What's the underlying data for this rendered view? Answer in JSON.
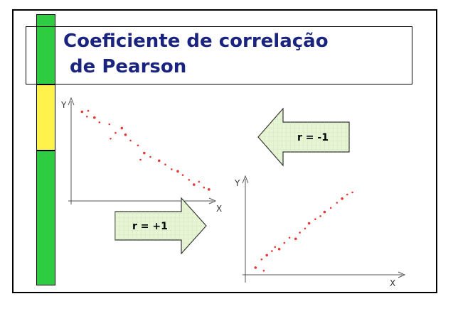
{
  "title": {
    "line1": "Coeficiente de correlação",
    "line2": " de Pearson"
  },
  "colors": {
    "bar_green": "#2ecc40",
    "bar_yellow": "#fff24d",
    "title_text": "#1a237e",
    "points": "#e53935",
    "arrow_fill": "#e7f5d4"
  },
  "arrows": {
    "negative": {
      "label": "r = -1",
      "direction": "left"
    },
    "positive": {
      "label": "r = +1",
      "direction": "right"
    }
  },
  "chart_data": [
    {
      "type": "scatter",
      "xlabel": "X",
      "ylabel": "Y",
      "points": [
        [
          0.3,
          9.3
        ],
        [
          0.8,
          9.4
        ],
        [
          0.7,
          8.8
        ],
        [
          1.3,
          8.7
        ],
        [
          1.7,
          8.2
        ],
        [
          2.5,
          8.0
        ],
        [
          3.5,
          7.6
        ],
        [
          3.0,
          7.1
        ],
        [
          2.6,
          6.5
        ],
        [
          3.8,
          6.9
        ],
        [
          4.2,
          6.3
        ],
        [
          4.8,
          5.8
        ],
        [
          5.3,
          5.0
        ],
        [
          5.0,
          4.3
        ],
        [
          5.8,
          4.6
        ],
        [
          6.5,
          4.2
        ],
        [
          7.0,
          3.8
        ],
        [
          7.5,
          3.3
        ],
        [
          8.0,
          3.1
        ],
        [
          8.4,
          2.7
        ],
        [
          8.9,
          2.2
        ],
        [
          9.3,
          1.7
        ],
        [
          9.7,
          2.0
        ],
        [
          10.1,
          1.4
        ],
        [
          10.5,
          1.2
        ]
      ]
    },
    {
      "type": "scatter",
      "xlabel": "X",
      "ylabel": "Y",
      "points": [
        [
          0.5,
          0.7
        ],
        [
          1.3,
          0.4
        ],
        [
          1.1,
          1.5
        ],
        [
          1.6,
          1.9
        ],
        [
          2.1,
          2.3
        ],
        [
          2.4,
          2.7
        ],
        [
          2.8,
          2.5
        ],
        [
          3.3,
          3.1
        ],
        [
          3.8,
          3.6
        ],
        [
          4.4,
          3.5
        ],
        [
          4.8,
          4.1
        ],
        [
          5.3,
          4.5
        ],
        [
          5.7,
          5.0
        ],
        [
          6.3,
          5.4
        ],
        [
          6.8,
          5.7
        ],
        [
          7.2,
          6.1
        ],
        [
          7.8,
          6.5
        ],
        [
          8.4,
          7.0
        ],
        [
          8.9,
          7.4
        ],
        [
          9.4,
          7.8
        ],
        [
          9.9,
          8.0
        ]
      ]
    }
  ]
}
